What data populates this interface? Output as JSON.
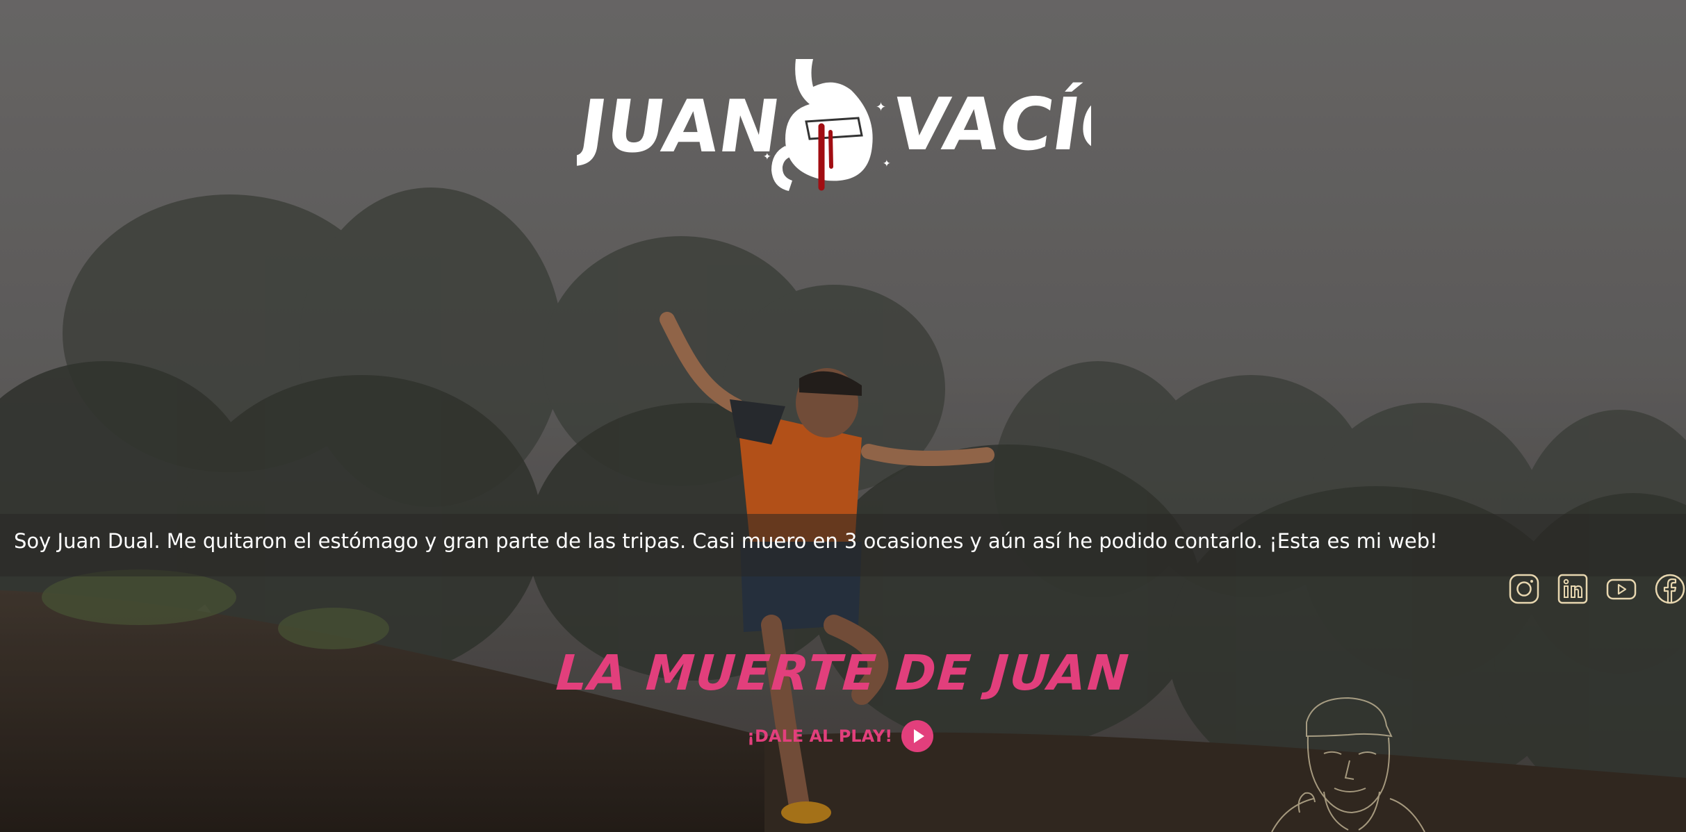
{
  "logo": {
    "word_left": "JUAN",
    "word_right": "VACÍO"
  },
  "intro": {
    "text": "Soy Juan Dual. Me quitaron el estómago y gran parte de las tripas. Casi muero en 3 ocasiones y aún así he podido contarlo. ¡Esta es mi web!"
  },
  "social": {
    "items": [
      {
        "icon": "instagram-icon"
      },
      {
        "icon": "linkedin-icon"
      },
      {
        "icon": "youtube-icon"
      },
      {
        "icon": "facebook-icon"
      }
    ]
  },
  "headline": {
    "text": "LA MUERTE DE JUAN"
  },
  "cta": {
    "label": "¡DALE AL PLAY!"
  },
  "colors": {
    "accent": "#e23f7c",
    "social_outline": "#e8d7b0",
    "blood": "#a10d12",
    "text": "#ffffff"
  }
}
